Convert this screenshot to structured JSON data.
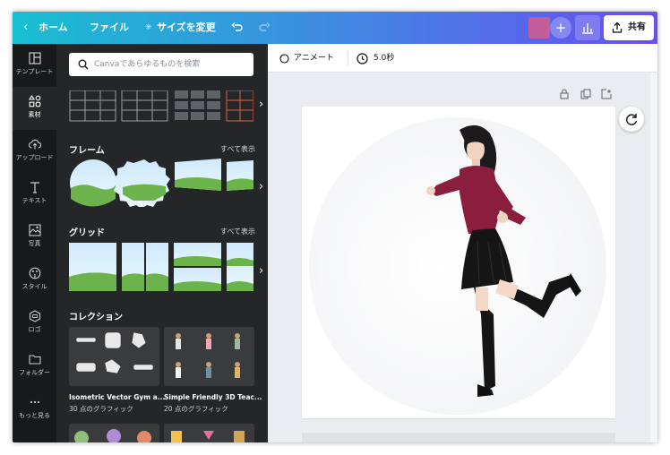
{
  "header": {
    "back_label": "ホーム",
    "file_label": "ファイル",
    "resize_label": "サイズを変更",
    "share_label": "共有"
  },
  "rail": {
    "items": [
      {
        "label": "テンプレート",
        "icon": "template-icon"
      },
      {
        "label": "素材",
        "icon": "elements-icon"
      },
      {
        "label": "アップロード",
        "icon": "upload-icon"
      },
      {
        "label": "テキスト",
        "icon": "text-icon"
      },
      {
        "label": "写真",
        "icon": "photo-icon"
      },
      {
        "label": "スタイル",
        "icon": "style-icon"
      },
      {
        "label": "ロゴ",
        "icon": "logo-icon"
      },
      {
        "label": "フォルダー",
        "icon": "folder-icon"
      },
      {
        "label": "もっと見る",
        "icon": "more-icon"
      }
    ]
  },
  "panel": {
    "search_placeholder": "Canvaであらゆるものを検索",
    "frames": {
      "title": "フレーム",
      "see_all": "すべて表示"
    },
    "grids": {
      "title": "グリッド",
      "see_all": "すべて表示"
    },
    "collections": {
      "title": "コレクション",
      "cards": [
        {
          "title": "Isometric Vector Gym a...",
          "subtitle": "30 点のグラフィック"
        },
        {
          "title": "Simple Friendly 3D Teac...",
          "subtitle": "20 点のグラフィック"
        }
      ]
    }
  },
  "editor": {
    "animate_label": "アニメート",
    "duration": "5.0秒"
  },
  "colors": {
    "header_start": "#18bfd1",
    "header_end": "#6a4ff0",
    "panel_bg": "#252627",
    "rail_bg": "#18191b",
    "sweater": "#8b1e3f"
  }
}
